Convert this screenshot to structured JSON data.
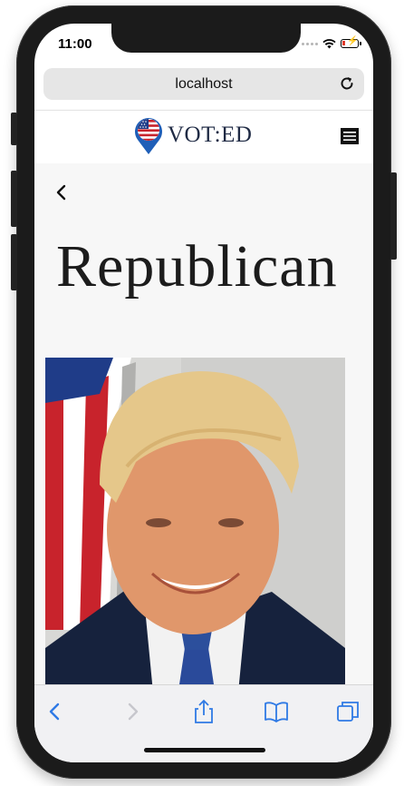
{
  "status_bar": {
    "time": "11:00"
  },
  "browser": {
    "url": "localhost"
  },
  "site": {
    "logo_text": "VOT:ED"
  },
  "page": {
    "title": "Republican",
    "portrait_alt": "Candidate portrait"
  },
  "colors": {
    "accent_blue": "#2f7ae5",
    "navy": "#1f2a44",
    "flag_red": "#c8232c"
  },
  "icons": {
    "reload": "reload-icon",
    "menu": "hamburger-menu-icon",
    "back": "chevron-left-icon",
    "toolbar_back": "chevron-left-icon",
    "toolbar_forward": "chevron-right-icon",
    "share": "share-icon",
    "bookmarks": "book-icon",
    "tabs": "tabs-icon"
  }
}
